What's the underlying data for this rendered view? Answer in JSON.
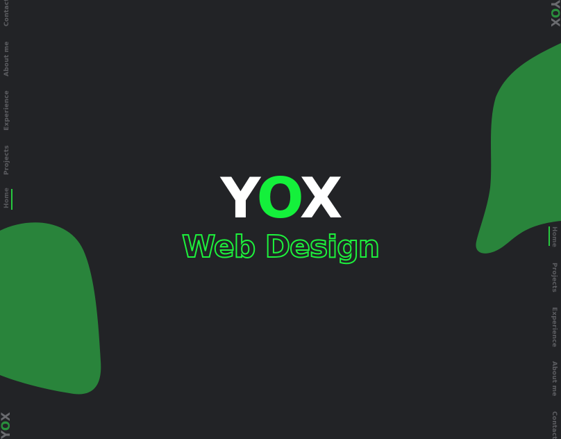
{
  "colors": {
    "background": "#222326",
    "blob": "#29843b",
    "accent": "#14f03b",
    "nav_text": "#5c5d61"
  },
  "brand": {
    "parts": [
      "Y",
      "O",
      "X"
    ],
    "tagline": "Web Design"
  },
  "corner_logo": {
    "parts": [
      "Y",
      "O",
      "X"
    ]
  },
  "nav_left": [
    "Home",
    "Projects",
    "Experience",
    "About me",
    "Contact"
  ],
  "nav_right": [
    "Home",
    "Projects",
    "Experience",
    "About me",
    "Contact"
  ],
  "active_nav": "Home"
}
